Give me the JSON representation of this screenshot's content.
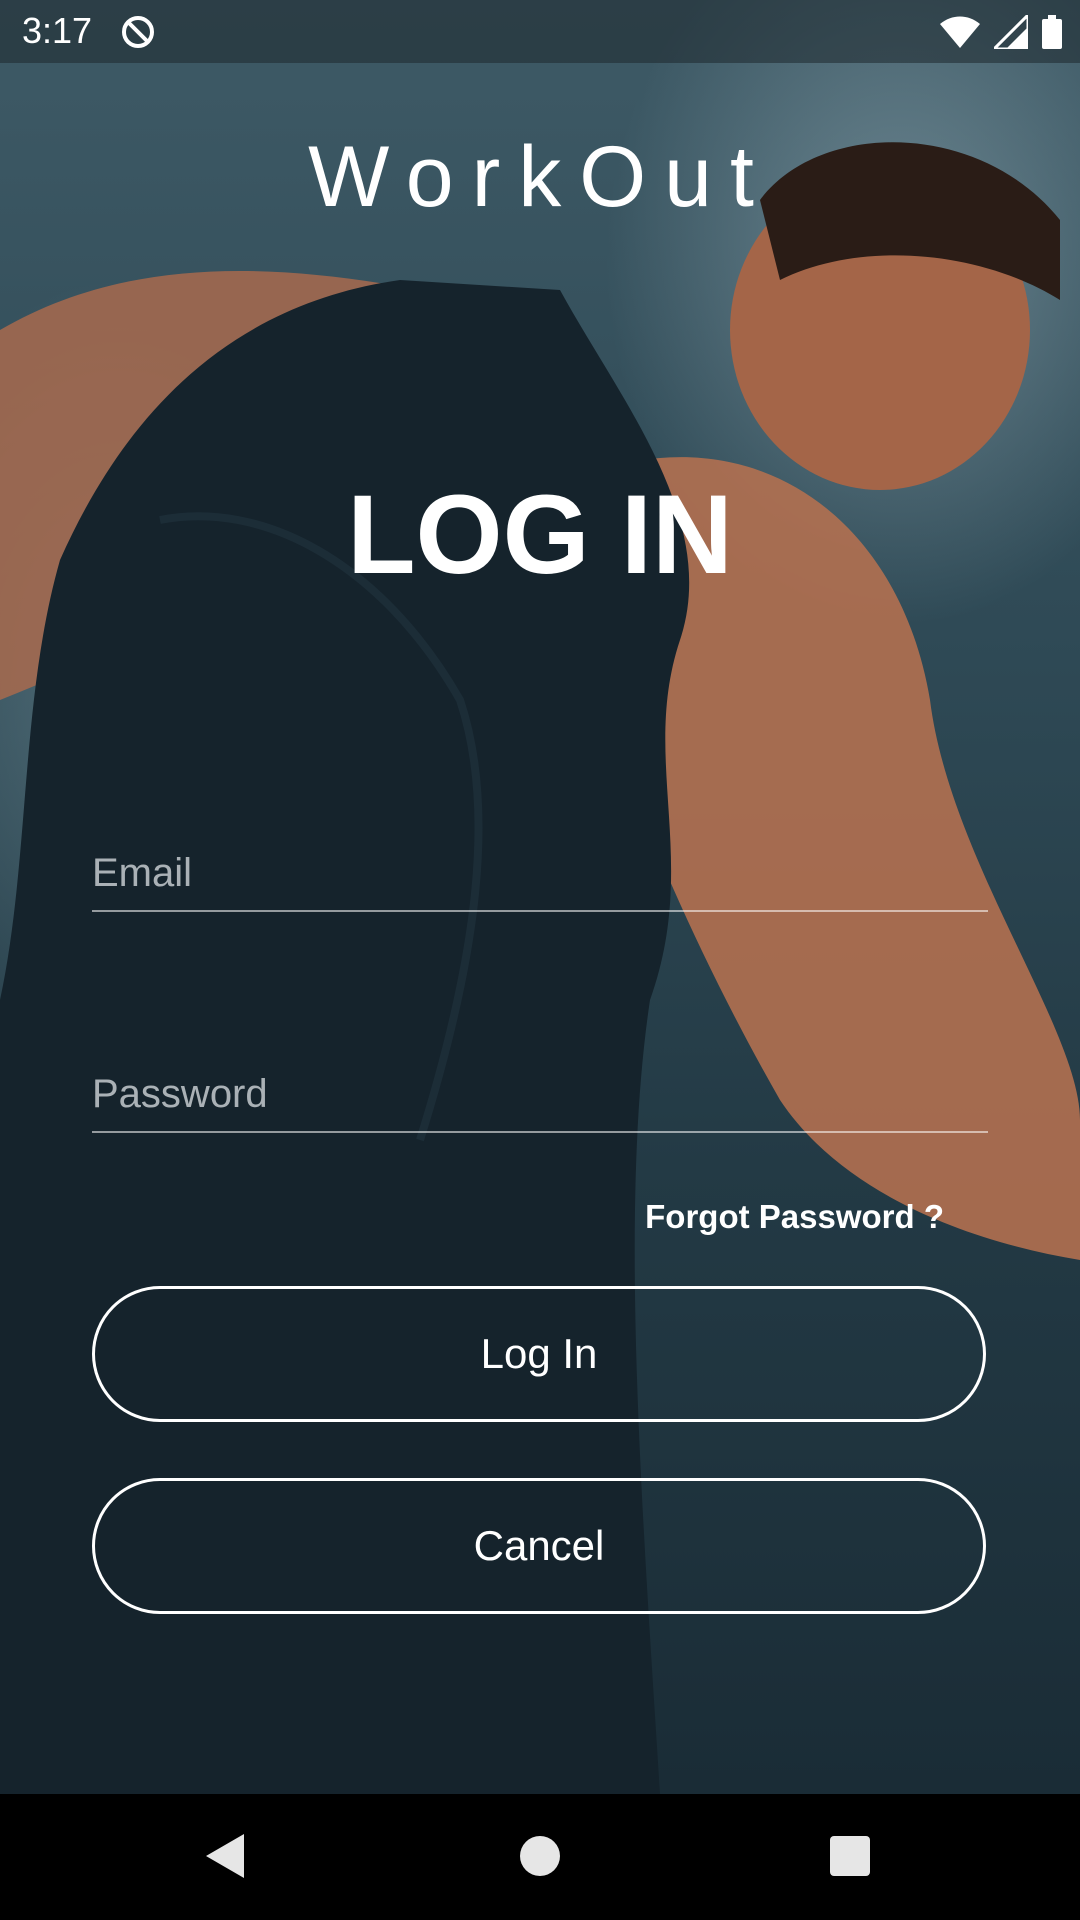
{
  "status_bar": {
    "time": "3:17",
    "app_icon": "circle-slash-icon",
    "wifi_icon": "wifi-icon",
    "signal_icon": "signal-icon",
    "battery_icon": "battery-icon"
  },
  "app": {
    "title": "WorkOut"
  },
  "login": {
    "heading": "LOG IN",
    "email_placeholder": "Email",
    "email_value": "",
    "password_placeholder": "Password",
    "password_value": "",
    "forgot_label": "Forgot Password ?",
    "login_label": "Log In",
    "cancel_label": "Cancel"
  },
  "nav_bar": {
    "back_icon": "back-triangle-icon",
    "home_icon": "home-circle-icon",
    "recents_icon": "recents-square-icon"
  },
  "colors": {
    "text": "#ffffff",
    "background_top": "#3e5a66",
    "background_bottom": "#1a2c36",
    "nav_bar": "#000000"
  }
}
